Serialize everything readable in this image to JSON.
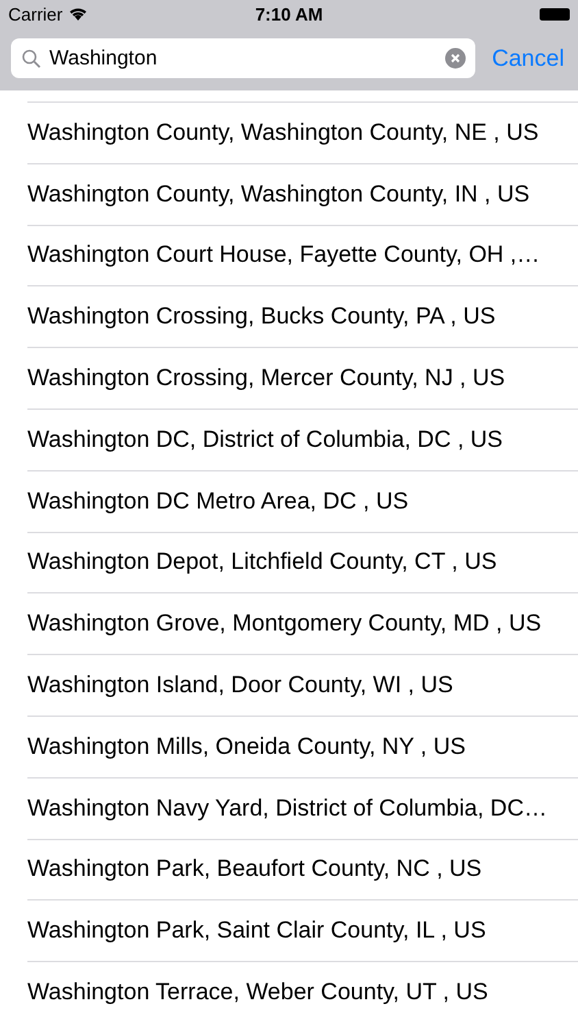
{
  "status_bar": {
    "carrier": "Carrier",
    "time": "7:10 AM"
  },
  "search": {
    "value": "Washington",
    "cancel": "Cancel"
  },
  "results": [
    "Washington County, Washington County, NE , US",
    "Washington County, Washington County, IN , US",
    "Washington Court House, Fayette County, OH ,…",
    "Washington Crossing, Bucks County, PA , US",
    "Washington Crossing, Mercer County, NJ , US",
    "Washington DC, District of Columbia, DC , US",
    "Washington DC Metro Area, DC , US",
    "Washington Depot, Litchfield County, CT , US",
    "Washington Grove, Montgomery County, MD , US",
    "Washington Island, Door County, WI , US",
    "Washington Mills, Oneida County, NY , US",
    "Washington Navy Yard, District of Columbia, DC…",
    "Washington Park, Beaufort County, NC , US",
    "Washington Park, Saint Clair County, IL , US",
    "Washington Terrace, Weber County, UT , US"
  ]
}
